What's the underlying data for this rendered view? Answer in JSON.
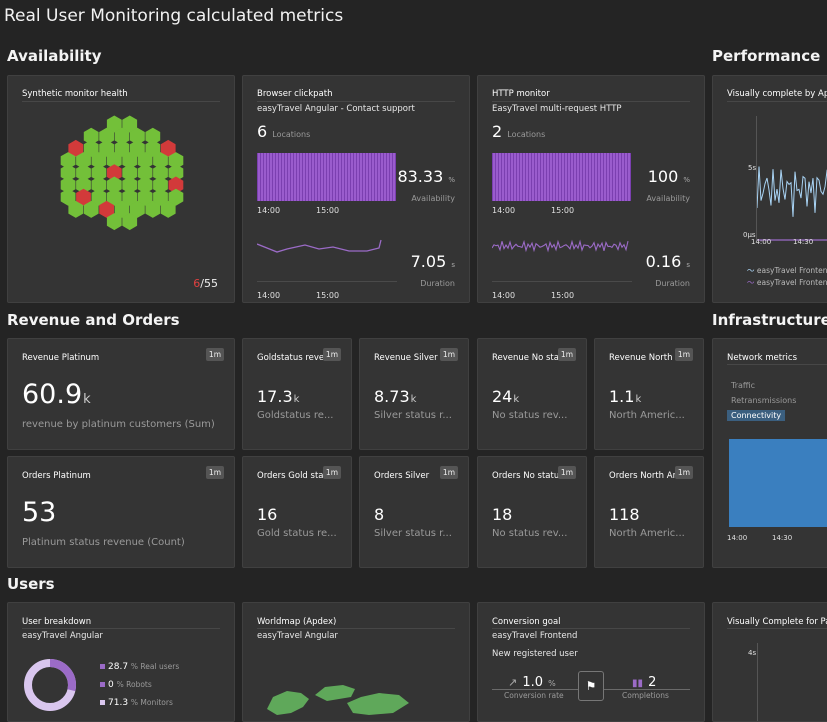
{
  "dashboard_title": "Real User Monitoring calculated metrics",
  "sections": {
    "availability": "Availability",
    "performance": "Performance",
    "revenue": "Revenue and Orders",
    "infrastructure": "Infrastructure",
    "users": "Users"
  },
  "synthetic": {
    "title": "Synthetic monitor health",
    "failing": "6",
    "total": "/55"
  },
  "browser_clickpath": {
    "title": "Browser clickpath",
    "subtitle": "easyTravel Angular - Contact support",
    "locations_count": "6",
    "locations_label": "Locations",
    "availability_value": "83.33",
    "availability_unit": "%",
    "availability_label": "Availability",
    "duration_value": "7.05",
    "duration_unit": "s",
    "duration_label": "Duration",
    "ticks": [
      "14:00",
      "15:00"
    ]
  },
  "http_monitor": {
    "title": "HTTP monitor",
    "subtitle": "EasyTravel multi-request HTTP",
    "locations_count": "2",
    "locations_label": "Locations",
    "availability_value": "100",
    "availability_unit": "%",
    "availability_label": "Availability",
    "duration_value": "0.16",
    "duration_unit": "s",
    "duration_label": "Duration",
    "ticks": [
      "14:00",
      "15:00"
    ]
  },
  "visually_complete": {
    "title": "Visually complete by Appl",
    "y_ticks": [
      "5s",
      "0µs"
    ],
    "x_ticks": [
      "14:00",
      "14:30"
    ],
    "legend": [
      "easyTravel Frontend",
      "easyTravel Frontend"
    ],
    "colors": [
      "#a9d4f5",
      "#9b6bc7"
    ]
  },
  "revenue_tiles": [
    {
      "title": "Revenue Platinum",
      "badge": "1m",
      "value": "60.9",
      "unit": "k",
      "desc": "revenue by platinum customers (Sum)"
    },
    {
      "title": "Goldstatus reve",
      "badge": "1m",
      "value": "17.3",
      "unit": "k",
      "desc": "Goldstatus re..."
    },
    {
      "title": "Revenue Silver",
      "badge": "1m",
      "value": "8.73",
      "unit": "k",
      "desc": "Silver status r..."
    },
    {
      "title": "Revenue No stat",
      "badge": "1m",
      "value": "24",
      "unit": "k",
      "desc": "No status rev..."
    },
    {
      "title": "Revenue North A",
      "badge": "1m",
      "value": "1.1",
      "unit": "k",
      "desc": "North Americ..."
    }
  ],
  "order_tiles": [
    {
      "title": "Orders Platinum",
      "badge": "1m",
      "value": "53",
      "desc": "Platinum status revenue (Count)"
    },
    {
      "title": "Orders Gold stat",
      "badge": "1m",
      "value": "16",
      "desc": "Gold status re..."
    },
    {
      "title": "Orders Silver",
      "badge": "1m",
      "value": "8",
      "desc": "Silver status r..."
    },
    {
      "title": "Orders No statu",
      "badge": "1m",
      "value": "18",
      "desc": "No status rev..."
    },
    {
      "title": "Orders North An",
      "badge": "1m",
      "value": "118",
      "desc": "North Americ..."
    }
  ],
  "network": {
    "title": "Network metrics",
    "options": [
      "Traffic",
      "Retransmissions",
      "Connectivity"
    ],
    "selected": "Connectivity",
    "x_ticks": [
      "14:00",
      "14:30"
    ],
    "color": "#3a7fbf"
  },
  "user_breakdown": {
    "title": "User breakdown",
    "subtitle": "easyTravel Angular",
    "rows": [
      {
        "value": "28.7",
        "label": "% Real users"
      },
      {
        "value": "0",
        "label": "% Robots"
      },
      {
        "value": "71.3",
        "label": "% Monitors"
      }
    ],
    "colors": [
      "#9b6bc7",
      "#d9c6ee"
    ]
  },
  "worldmap": {
    "title": "Worldmap (Apdex)",
    "subtitle": "easyTravel Angular",
    "color": "#5fa85a"
  },
  "conversion": {
    "title": "Conversion goal",
    "subtitle": "easyTravel Frontend",
    "goal": "New registered user",
    "rate_value": "1.0",
    "rate_unit": "%",
    "rate_label": "Conversion rate",
    "completions_value": "2",
    "completions_label": "Completions"
  },
  "visually_complete_pages": {
    "title": "Visually Complete for Pag",
    "y_tick": "4s"
  },
  "hex_colors": {
    "healthy": "#73c039",
    "failing": "#d23a3a"
  }
}
